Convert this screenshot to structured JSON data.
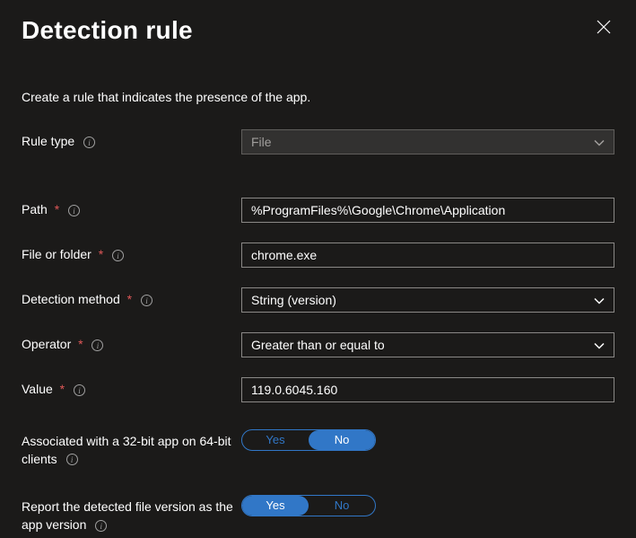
{
  "header": {
    "title": "Detection rule"
  },
  "subtitle": "Create a rule that indicates the presence of the app.",
  "fields": {
    "ruleType": {
      "label": "Rule type",
      "value": "File"
    },
    "path": {
      "label": "Path",
      "value": "%ProgramFiles%\\Google\\Chrome\\Application"
    },
    "fileOrFolder": {
      "label": "File or folder",
      "value": "chrome.exe"
    },
    "detectionMethod": {
      "label": "Detection method",
      "value": "String (version)"
    },
    "operator": {
      "label": "Operator",
      "value": "Greater than or equal to"
    },
    "valueField": {
      "label": "Value",
      "value": "119.0.6045.160"
    },
    "assoc32": {
      "label": "Associated with a 32-bit app on 64-bit clients",
      "yes": "Yes",
      "no": "No"
    },
    "reportVersion": {
      "label": "Report the detected file version as the app version",
      "yes": "Yes",
      "no": "No"
    }
  }
}
